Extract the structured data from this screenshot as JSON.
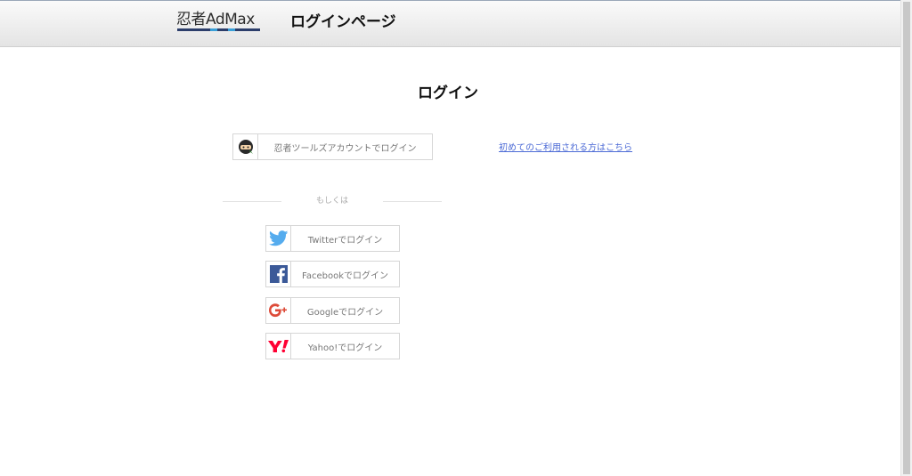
{
  "header": {
    "logo_text": "忍者AdMax",
    "title": "ログインページ"
  },
  "main": {
    "heading": "ログイン",
    "ninja_login_label": "忍者ツールズアカウントでログイン",
    "first_time_link": "初めてのご利用される方はこちら",
    "divider_text": "もしくは",
    "social_logins": [
      {
        "label": "Twitterでログイン",
        "icon": "twitter-icon",
        "color": "#55acee"
      },
      {
        "label": "Facebookでログイン",
        "icon": "facebook-icon",
        "color": "#3b5998"
      },
      {
        "label": "Googleでログイン",
        "icon": "google-plus-icon",
        "color": "#dd4b39"
      },
      {
        "label": "Yahoo!でログイン",
        "icon": "yahoo-icon",
        "color": "#ff0033"
      }
    ]
  },
  "colors": {
    "link": "#4d6bd6",
    "logo_navy": "#2c3e6b",
    "logo_accent": "#3aa0d8"
  }
}
